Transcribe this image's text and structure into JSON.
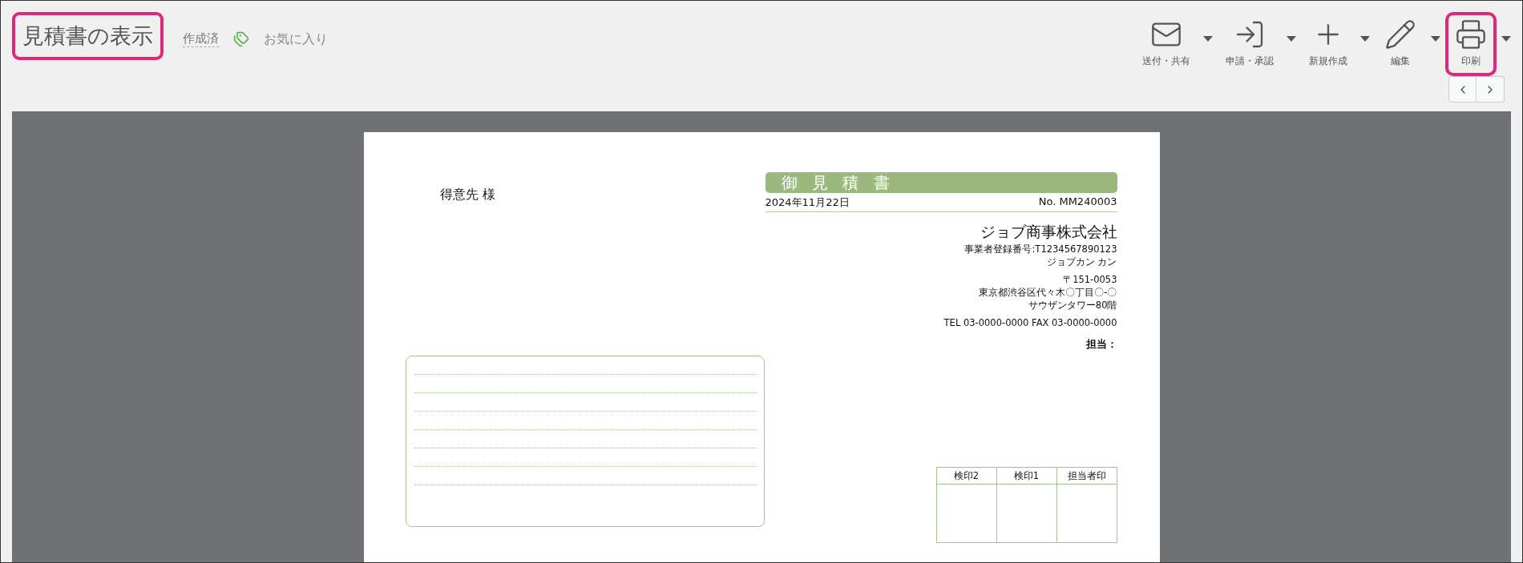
{
  "header": {
    "title": {
      "text": "見積書の表示",
      "highlighted": true
    },
    "status": "作成済",
    "favorite": "お気に入り"
  },
  "toolbar": [
    {
      "kind": "mail",
      "label": "送付・共有",
      "highlighted": false
    },
    {
      "kind": "submit",
      "label": "申請・承認",
      "highlighted": false
    },
    {
      "kind": "new",
      "label": "新規作成",
      "highlighted": false
    },
    {
      "kind": "edit",
      "label": "編集",
      "highlighted": false
    },
    {
      "kind": "print",
      "label": "印刷",
      "highlighted": true
    }
  ],
  "document": {
    "customer": "得意先 様",
    "title": "御 見 積 書",
    "date": "2024年11月22日",
    "number": "No. MM240003",
    "company": "ジョブ商事株式会社",
    "registration": "事業者登録番号:T1234567890123",
    "contact": "ジョブカン カン",
    "postal": "〒151-0053",
    "address": "東京都渋谷区代々木〇丁目〇-〇",
    "building": "サウザンタワー80階",
    "phone": "TEL 03-0000-0000 FAX 03-0000-0000",
    "person": "担当：",
    "stamps": [
      "検印2",
      "検印1",
      "担当者印"
    ]
  }
}
